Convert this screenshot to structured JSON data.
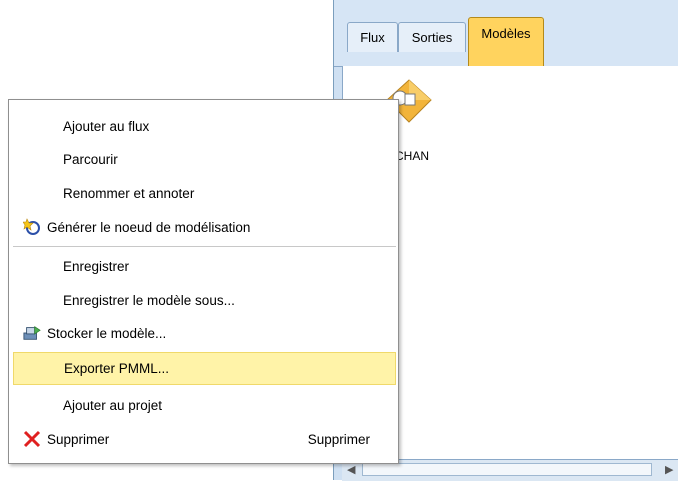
{
  "tabs": [
    {
      "label": "Flux"
    },
    {
      "label": "Sorties"
    },
    {
      "label": "Modèles",
      "active": true
    }
  ],
  "model_node": {
    "label": "CHAN",
    "icon": "model-nugget-icon"
  },
  "menu": {
    "items": [
      {
        "label": "Ajouter au flux",
        "icon": ""
      },
      {
        "label": "Parcourir",
        "icon": ""
      },
      {
        "label": "Renommer et annoter",
        "icon": ""
      },
      {
        "label": "Générer le noeud de modélisation",
        "icon": "generate-icon"
      },
      {
        "label": "Enregistrer",
        "icon": ""
      },
      {
        "label": "Enregistrer le modèle sous...",
        "icon": ""
      },
      {
        "label": "Stocker le modèle...",
        "icon": "store-icon"
      },
      {
        "label": "Exporter PMML...",
        "icon": "",
        "highlighted": true
      },
      {
        "label": "Ajouter au projet",
        "icon": ""
      },
      {
        "label": "Supprimer",
        "icon": "delete-icon",
        "shortcut": "Supprimer"
      }
    ]
  }
}
